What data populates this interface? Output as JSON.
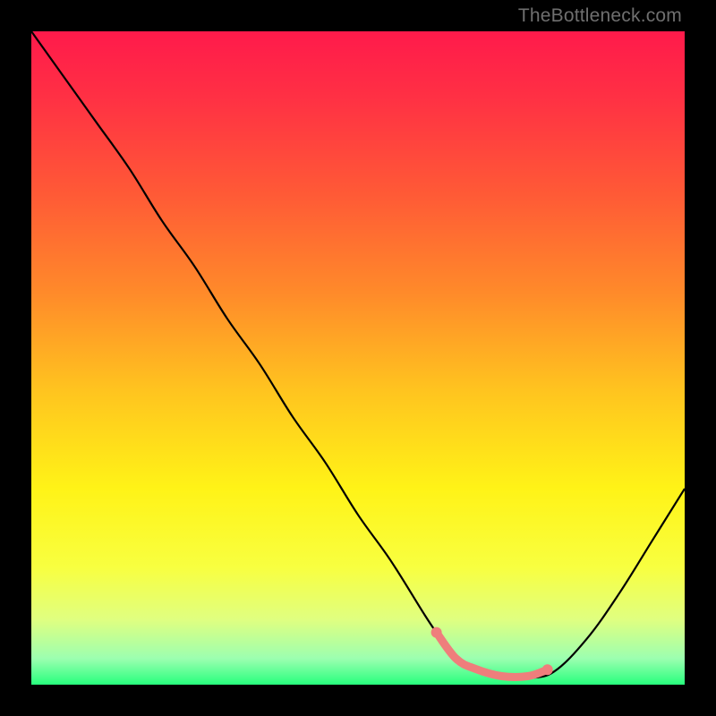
{
  "watermark": "TheBottleneck.com",
  "chart_data": {
    "type": "line",
    "title": "",
    "xlabel": "",
    "ylabel": "",
    "xlim": [
      0,
      100
    ],
    "ylim": [
      0,
      100
    ],
    "grid": false,
    "legend": false,
    "series": [
      {
        "name": "bottleneck-curve",
        "x": [
          0,
          5,
          10,
          15,
          20,
          25,
          30,
          35,
          40,
          45,
          50,
          55,
          60,
          62,
          65,
          68,
          72,
          76,
          80,
          85,
          90,
          95,
          100
        ],
        "y": [
          100,
          93,
          86,
          79,
          71,
          64,
          56,
          49,
          41,
          34,
          26,
          19,
          11,
          8,
          4,
          2,
          1,
          1,
          2,
          7,
          14,
          22,
          30
        ]
      }
    ],
    "highlight": {
      "name": "optimal-range",
      "x": [
        62,
        65,
        68,
        72,
        76,
        79
      ],
      "y": [
        8,
        4,
        2.4,
        1.3,
        1.3,
        2.3
      ],
      "color": "#ef7e7c"
    },
    "gradient_stops": [
      {
        "offset": 0.0,
        "color": "#ff1a4b"
      },
      {
        "offset": 0.1,
        "color": "#ff3044"
      },
      {
        "offset": 0.25,
        "color": "#ff5a36"
      },
      {
        "offset": 0.4,
        "color": "#ff8a2a"
      },
      {
        "offset": 0.55,
        "color": "#ffc41f"
      },
      {
        "offset": 0.7,
        "color": "#fff317"
      },
      {
        "offset": 0.82,
        "color": "#f8ff40"
      },
      {
        "offset": 0.9,
        "color": "#e0ff80"
      },
      {
        "offset": 0.96,
        "color": "#9cffb0"
      },
      {
        "offset": 1.0,
        "color": "#27ff7d"
      }
    ]
  }
}
